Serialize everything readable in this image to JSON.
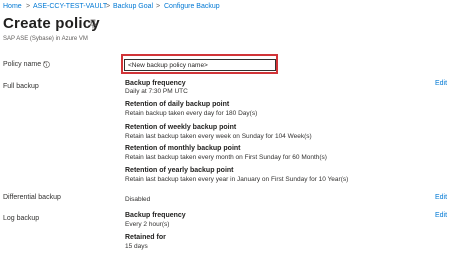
{
  "breadcrumb": {
    "items": [
      "Home",
      "ASE-CCY-TEST-VAULT",
      "Backup Goal",
      "Configure Backup"
    ],
    "separator": ">"
  },
  "header": {
    "title": "Create policy",
    "pin_icon": "pin-icon",
    "subtitle": "SAP ASE (Sybase) in Azure VM"
  },
  "form": {
    "policy_name_label": "Policy name *",
    "policy_name_value": "<New backup policy name>"
  },
  "full_backup": {
    "label": "Full backup",
    "edit_label": "Edit",
    "sections": [
      {
        "heading": "Backup frequency",
        "value": "Daily at 7:30 PM UTC"
      },
      {
        "heading": "Retention of daily backup point",
        "value": "Retain backup taken every day for 180 Day(s)"
      },
      {
        "heading": "Retention of weekly backup point",
        "value": "Retain last backup taken every week on Sunday for 104 Week(s)"
      },
      {
        "heading": "Retention of monthly backup point",
        "value": "Retain last backup taken every month on First Sunday for 60 Month(s)"
      },
      {
        "heading": "Retention of yearly backup point",
        "value": "Retain last backup taken every year in January on First Sunday for 10 Year(s)"
      }
    ]
  },
  "differential_backup": {
    "label": "Differential backup",
    "value": "Disabled",
    "edit_label": "Edit"
  },
  "log_backup": {
    "label": "Log backup",
    "edit_label": "Edit",
    "sections": [
      {
        "heading": "Backup frequency",
        "value": "Every 2 hour(s)"
      },
      {
        "heading": "Retained for",
        "value": "15 days"
      }
    ]
  },
  "colors": {
    "link": "#0078d4",
    "highlight": "#d13438"
  }
}
